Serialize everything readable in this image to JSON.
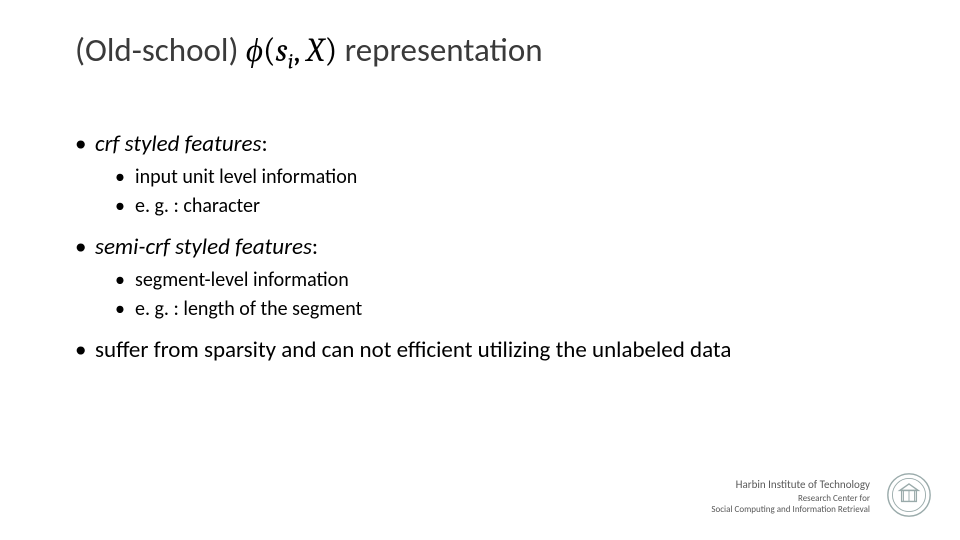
{
  "title": {
    "prefix": "(Old-school) ",
    "phi": "ϕ",
    "open": "(",
    "arg1": "s",
    "arg1sub": "i",
    "comma": ", ",
    "arg2": "X",
    "close": ")",
    "suffix": " representation"
  },
  "bullets": [
    {
      "text": "crf styled features",
      "after": ":",
      "sub": [
        "input unit level information",
        "e. g. : character"
      ]
    },
    {
      "text": "semi-crf styled features",
      "after": ":",
      "sub": [
        "segment-level information",
        "e. g. : length of the segment"
      ]
    },
    {
      "text": "suffer from sparsity and can not efficient utilizing the unlabeled data"
    }
  ],
  "footer": {
    "line1": "Harbin Institute of Technology",
    "line2": "Research Center for",
    "line3": "Social Computing and Information Retrieval"
  }
}
